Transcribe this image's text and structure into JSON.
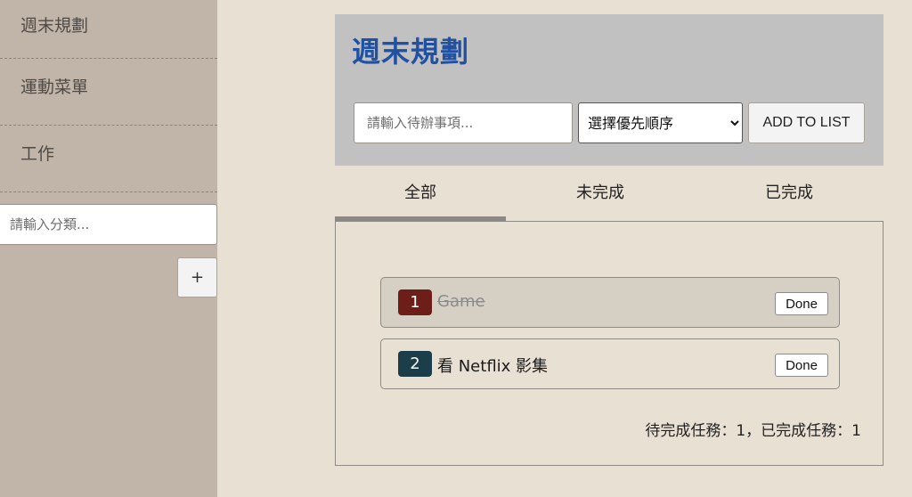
{
  "sidebar": {
    "categories": [
      "週末規劃",
      "運動菜單",
      "工作"
    ],
    "category_input_placeholder": "請輸入分類...",
    "add_button_label": "+"
  },
  "header": {
    "title": "週末規劃",
    "todo_input_placeholder": "請輸入待辦事項...",
    "priority_selected": "選擇優先順序",
    "add_button_label": "ADD TO LIST"
  },
  "tabs": [
    {
      "label": "全部",
      "active": true
    },
    {
      "label": "未完成",
      "active": false
    },
    {
      "label": "已完成",
      "active": false
    }
  ],
  "todos": [
    {
      "number": "1",
      "text": "Game",
      "completed": true,
      "badge_color": "#6e1e19",
      "button_label": "Done"
    },
    {
      "number": "2",
      "text": "看 Netflix 影集",
      "completed": false,
      "badge_color": "#1c3d4a",
      "button_label": "Done"
    }
  ],
  "summary": "待完成任務：1，已完成任務：1",
  "colors": {
    "title": "#2151a3",
    "sidebar_bg": "#c1b5a9",
    "page_bg": "#e9e0d4",
    "header_bg": "#c1c1c1"
  }
}
